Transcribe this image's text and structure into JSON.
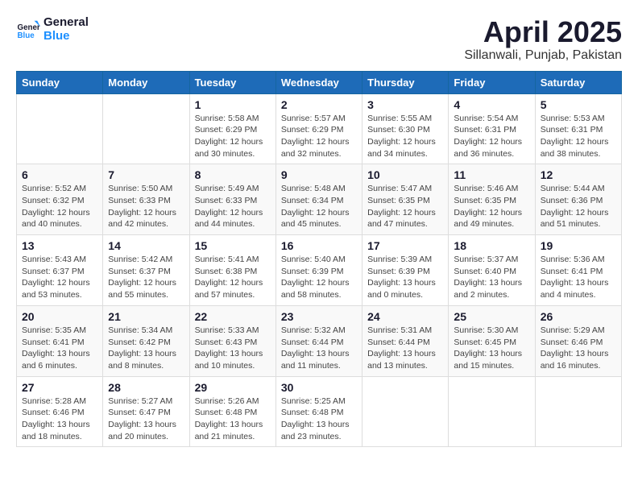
{
  "logo": {
    "general": "General",
    "blue": "Blue"
  },
  "title": "April 2025",
  "location": "Sillanwali, Punjab, Pakistan",
  "weekdays": [
    "Sunday",
    "Monday",
    "Tuesday",
    "Wednesday",
    "Thursday",
    "Friday",
    "Saturday"
  ],
  "weeks": [
    [
      {
        "day": "",
        "info": ""
      },
      {
        "day": "",
        "info": ""
      },
      {
        "day": "1",
        "info": "Sunrise: 5:58 AM\nSunset: 6:29 PM\nDaylight: 12 hours\nand 30 minutes."
      },
      {
        "day": "2",
        "info": "Sunrise: 5:57 AM\nSunset: 6:29 PM\nDaylight: 12 hours\nand 32 minutes."
      },
      {
        "day": "3",
        "info": "Sunrise: 5:55 AM\nSunset: 6:30 PM\nDaylight: 12 hours\nand 34 minutes."
      },
      {
        "day": "4",
        "info": "Sunrise: 5:54 AM\nSunset: 6:31 PM\nDaylight: 12 hours\nand 36 minutes."
      },
      {
        "day": "5",
        "info": "Sunrise: 5:53 AM\nSunset: 6:31 PM\nDaylight: 12 hours\nand 38 minutes."
      }
    ],
    [
      {
        "day": "6",
        "info": "Sunrise: 5:52 AM\nSunset: 6:32 PM\nDaylight: 12 hours\nand 40 minutes."
      },
      {
        "day": "7",
        "info": "Sunrise: 5:50 AM\nSunset: 6:33 PM\nDaylight: 12 hours\nand 42 minutes."
      },
      {
        "day": "8",
        "info": "Sunrise: 5:49 AM\nSunset: 6:33 PM\nDaylight: 12 hours\nand 44 minutes."
      },
      {
        "day": "9",
        "info": "Sunrise: 5:48 AM\nSunset: 6:34 PM\nDaylight: 12 hours\nand 45 minutes."
      },
      {
        "day": "10",
        "info": "Sunrise: 5:47 AM\nSunset: 6:35 PM\nDaylight: 12 hours\nand 47 minutes."
      },
      {
        "day": "11",
        "info": "Sunrise: 5:46 AM\nSunset: 6:35 PM\nDaylight: 12 hours\nand 49 minutes."
      },
      {
        "day": "12",
        "info": "Sunrise: 5:44 AM\nSunset: 6:36 PM\nDaylight: 12 hours\nand 51 minutes."
      }
    ],
    [
      {
        "day": "13",
        "info": "Sunrise: 5:43 AM\nSunset: 6:37 PM\nDaylight: 12 hours\nand 53 minutes."
      },
      {
        "day": "14",
        "info": "Sunrise: 5:42 AM\nSunset: 6:37 PM\nDaylight: 12 hours\nand 55 minutes."
      },
      {
        "day": "15",
        "info": "Sunrise: 5:41 AM\nSunset: 6:38 PM\nDaylight: 12 hours\nand 57 minutes."
      },
      {
        "day": "16",
        "info": "Sunrise: 5:40 AM\nSunset: 6:39 PM\nDaylight: 12 hours\nand 58 minutes."
      },
      {
        "day": "17",
        "info": "Sunrise: 5:39 AM\nSunset: 6:39 PM\nDaylight: 13 hours\nand 0 minutes."
      },
      {
        "day": "18",
        "info": "Sunrise: 5:37 AM\nSunset: 6:40 PM\nDaylight: 13 hours\nand 2 minutes."
      },
      {
        "day": "19",
        "info": "Sunrise: 5:36 AM\nSunset: 6:41 PM\nDaylight: 13 hours\nand 4 minutes."
      }
    ],
    [
      {
        "day": "20",
        "info": "Sunrise: 5:35 AM\nSunset: 6:41 PM\nDaylight: 13 hours\nand 6 minutes."
      },
      {
        "day": "21",
        "info": "Sunrise: 5:34 AM\nSunset: 6:42 PM\nDaylight: 13 hours\nand 8 minutes."
      },
      {
        "day": "22",
        "info": "Sunrise: 5:33 AM\nSunset: 6:43 PM\nDaylight: 13 hours\nand 10 minutes."
      },
      {
        "day": "23",
        "info": "Sunrise: 5:32 AM\nSunset: 6:44 PM\nDaylight: 13 hours\nand 11 minutes."
      },
      {
        "day": "24",
        "info": "Sunrise: 5:31 AM\nSunset: 6:44 PM\nDaylight: 13 hours\nand 13 minutes."
      },
      {
        "day": "25",
        "info": "Sunrise: 5:30 AM\nSunset: 6:45 PM\nDaylight: 13 hours\nand 15 minutes."
      },
      {
        "day": "26",
        "info": "Sunrise: 5:29 AM\nSunset: 6:46 PM\nDaylight: 13 hours\nand 16 minutes."
      }
    ],
    [
      {
        "day": "27",
        "info": "Sunrise: 5:28 AM\nSunset: 6:46 PM\nDaylight: 13 hours\nand 18 minutes."
      },
      {
        "day": "28",
        "info": "Sunrise: 5:27 AM\nSunset: 6:47 PM\nDaylight: 13 hours\nand 20 minutes."
      },
      {
        "day": "29",
        "info": "Sunrise: 5:26 AM\nSunset: 6:48 PM\nDaylight: 13 hours\nand 21 minutes."
      },
      {
        "day": "30",
        "info": "Sunrise: 5:25 AM\nSunset: 6:48 PM\nDaylight: 13 hours\nand 23 minutes."
      },
      {
        "day": "",
        "info": ""
      },
      {
        "day": "",
        "info": ""
      },
      {
        "day": "",
        "info": ""
      }
    ]
  ]
}
